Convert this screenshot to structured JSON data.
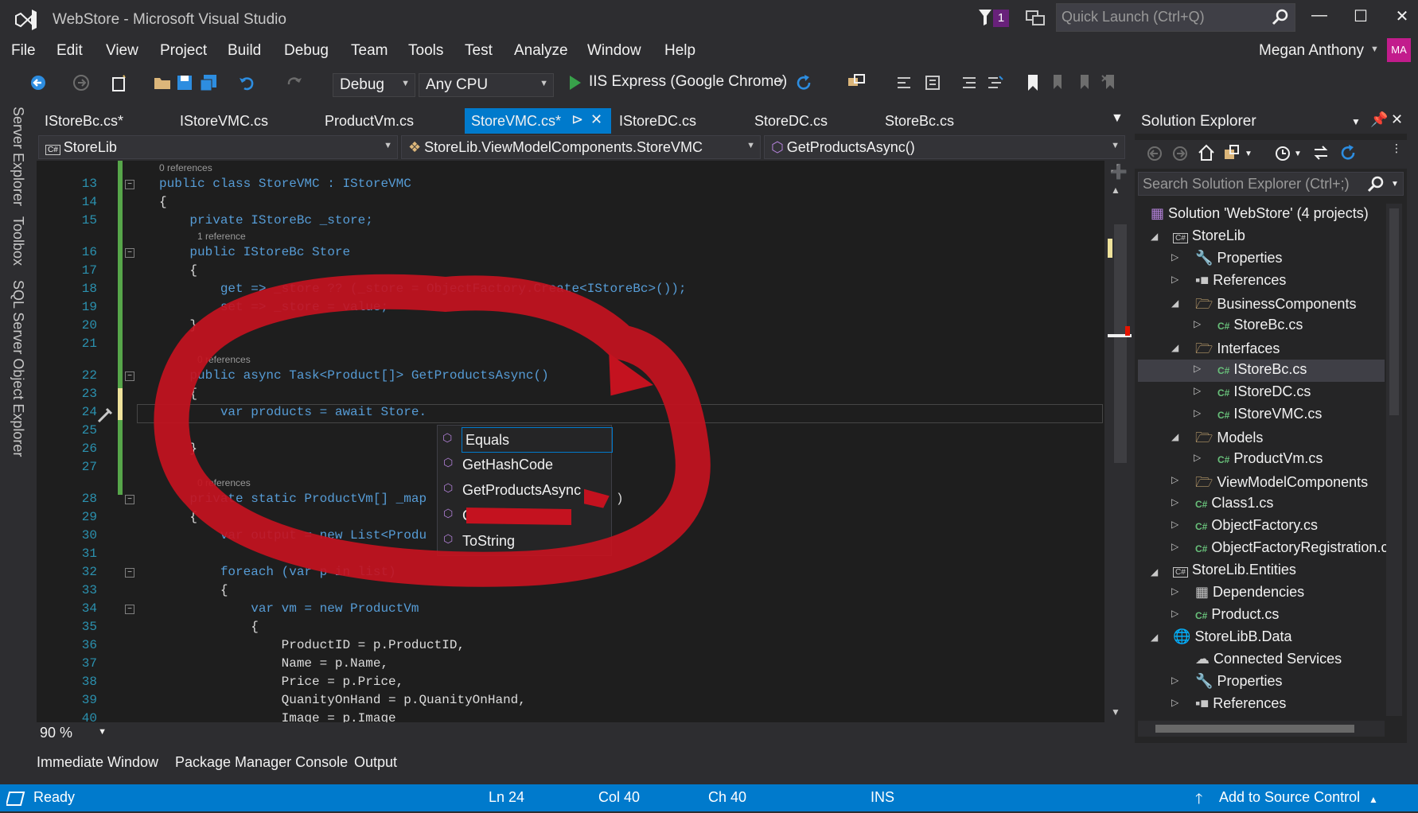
{
  "window": {
    "title": "WebStore - Microsoft Visual Studio",
    "notification_count": "1",
    "quick_launch_placeholder": "Quick Launch (Ctrl+Q)"
  },
  "menu": [
    "File",
    "Edit",
    "View",
    "Project",
    "Build",
    "Debug",
    "Team",
    "Tools",
    "Test",
    "Analyze",
    "Window",
    "Help"
  ],
  "user": {
    "name": "Megan Anthony",
    "initials": "MA"
  },
  "toolbar": {
    "config": "Debug",
    "platform": "Any CPU",
    "run_target": "IIS Express (Google Chrome)"
  },
  "left_tabs": [
    "Server Explorer",
    "Toolbox",
    "SQL Server Object Explorer"
  ],
  "doc_tabs": [
    "IStoreBc.cs*",
    "IStoreVMC.cs",
    "ProductVm.cs",
    "StoreVMC.cs*",
    "IStoreDC.cs",
    "StoreDC.cs",
    "StoreBc.cs"
  ],
  "nav": {
    "project": "StoreLib",
    "type": "StoreLib.ViewModelComponents.StoreVMC",
    "member": "GetProductsAsync()"
  },
  "editor": {
    "line_numbers": [
      "13",
      "14",
      "15",
      "16",
      "17",
      "18",
      "19",
      "20",
      "21",
      "22",
      "23",
      "24",
      "25",
      "26",
      "27",
      "28",
      "29",
      "30",
      "31",
      "32",
      "33",
      "34",
      "35",
      "36",
      "37",
      "38",
      "39",
      "40"
    ],
    "ref_hints": {
      "h1": "0 references",
      "h2": "1 reference",
      "h3": "0 references",
      "h4": "0 references"
    },
    "lines": {
      "l13": "public class StoreVMC : IStoreVMC",
      "l14": "{",
      "l15": "    private IStoreBc _store;",
      "l16": "    public IStoreBc Store",
      "l17": "    {",
      "l18": "        get => _store ?? (_store = ObjectFactory.Create<IStoreBc>());",
      "l19": "        set => _store = value;",
      "l20": "    }",
      "l22": "    public async Task<Product[]> GetProductsAsync()",
      "l23": "    {",
      "l24": "        var products = await Store.",
      "l26": "    }",
      "l28": "    private static ProductVm[] _map",
      "l28b": ")",
      "l29": "    {",
      "l30": "        var output = new List<Produ",
      "l32": "        foreach (var p in list)",
      "l33": "        {",
      "l34": "            var vm = new ProductVm",
      "l35": "            {",
      "l36": "                ProductID = p.ProductID,",
      "l37": "                Name = p.Name,",
      "l38": "                Price = p.Price,",
      "l39": "                QuanityOnHand = p.QuanityOnHand,",
      "l40": "                Image = p.Image"
    },
    "zoom": "90 %"
  },
  "intellisense": [
    "Equals",
    "GetHashCode",
    "GetProductsAsync",
    "GetType",
    "ToString"
  ],
  "solution_explorer": {
    "title": "Solution Explorer",
    "search_placeholder": "Search Solution Explorer (Ctrl+;)",
    "items": [
      "Solution 'WebStore' (4 projects)",
      "StoreLib",
      "Properties",
      "References",
      "BusinessComponents",
      "StoreBc.cs",
      "Interfaces",
      "IStoreBc.cs",
      "IStoreDC.cs",
      "IStoreVMC.cs",
      "Models",
      "ProductVm.cs",
      "ViewModelComponents",
      "Class1.cs",
      "ObjectFactory.cs",
      "ObjectFactoryRegistration.cs",
      "StoreLib.Entities",
      "Dependencies",
      "Product.cs",
      "StoreLibB.Data",
      "Connected Services",
      "Properties",
      "References"
    ]
  },
  "bottom_tabs": [
    "Immediate Window",
    "Package Manager Console",
    "Output"
  ],
  "status": {
    "state": "Ready",
    "line": "Ln 24",
    "col": "Col 40",
    "ch": "Ch 40",
    "mode": "INS",
    "source_control": "Add to Source Control"
  },
  "colors": {
    "accent": "#007acc",
    "editor_bg": "#1e1e1e",
    "keyword": "#569cd6",
    "type": "#4ec9b0",
    "annotation": "#c4121f"
  }
}
